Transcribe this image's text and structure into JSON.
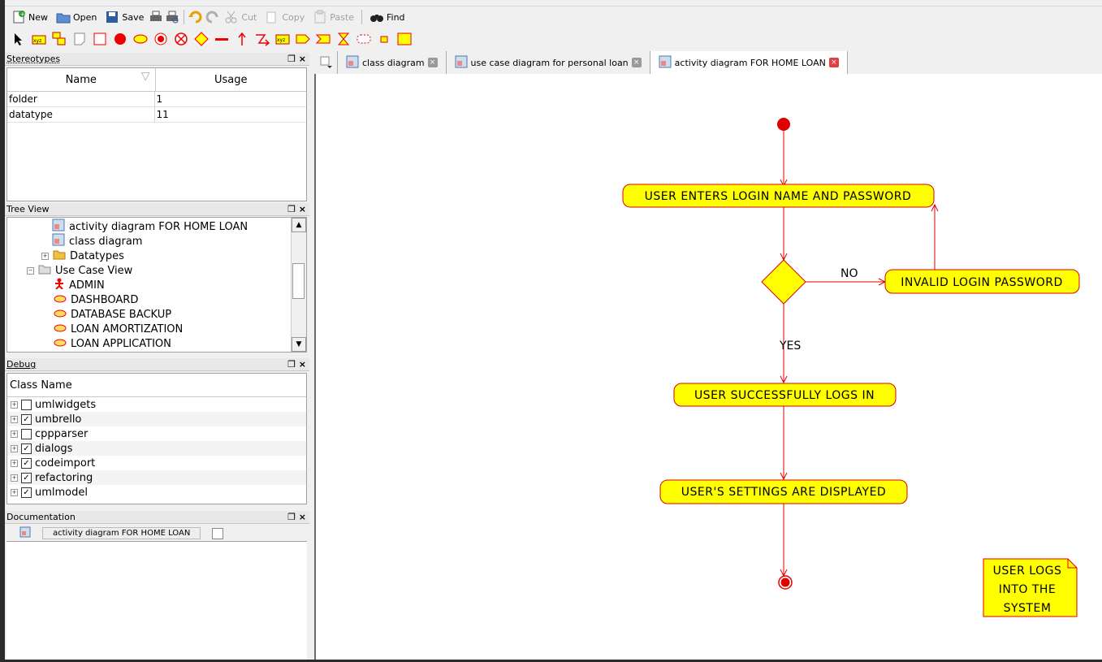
{
  "toolbar": {
    "new_label": "New",
    "open_label": "Open",
    "save_label": "Save",
    "cut_label": "Cut",
    "copy_label": "Copy",
    "paste_label": "Paste",
    "find_label": "Find"
  },
  "stereotypes": {
    "title": "Stereotypes",
    "col_name": "Name",
    "col_usage": "Usage",
    "rows": [
      {
        "name": "folder",
        "usage": "1"
      },
      {
        "name": "datatype",
        "usage": "11"
      }
    ]
  },
  "tree": {
    "title": "Tree View",
    "items": [
      "activity diagram FOR HOME LOAN",
      "class diagram",
      "Datatypes",
      "Use Case View",
      "ADMIN",
      "DASHBOARD",
      "DATABASE BACKUP",
      "LOAN AMORTIZATION",
      "LOAN APPLICATION"
    ]
  },
  "debug": {
    "title": "Debug",
    "col": "Class Name",
    "rows": [
      {
        "label": "umlwidgets",
        "checked": false
      },
      {
        "label": "umbrello",
        "checked": true
      },
      {
        "label": "cppparser",
        "checked": false
      },
      {
        "label": "dialogs",
        "checked": true
      },
      {
        "label": "codeimport",
        "checked": true
      },
      {
        "label": "refactoring",
        "checked": true
      },
      {
        "label": "umlmodel",
        "checked": true
      }
    ]
  },
  "documentation": {
    "title": "Documentation",
    "item": "activity diagram FOR HOME LOAN"
  },
  "tabs": [
    {
      "label": "class diagram",
      "active": false
    },
    {
      "label": "use case diagram for personal loan",
      "active": false
    },
    {
      "label": "activity diagram FOR HOME LOAN",
      "active": true
    }
  ],
  "diagram": {
    "act1": "USER ENTERS LOGIN NAME AND PASSWORD",
    "act2": "INVALID LOGIN PASSWORD",
    "act3": "USER SUCCESSFULLY LOGS IN",
    "act4": "USER'S SETTINGS ARE DISPLAYED",
    "no_label": "NO",
    "yes_label": "YES",
    "note_line1": "USER LOGS",
    "note_line2": "INTO THE",
    "note_line3": "SYSTEM"
  },
  "colors": {
    "activity_fill": "#ffff00",
    "line": "#e00000",
    "note_fill": "#ffff00"
  }
}
